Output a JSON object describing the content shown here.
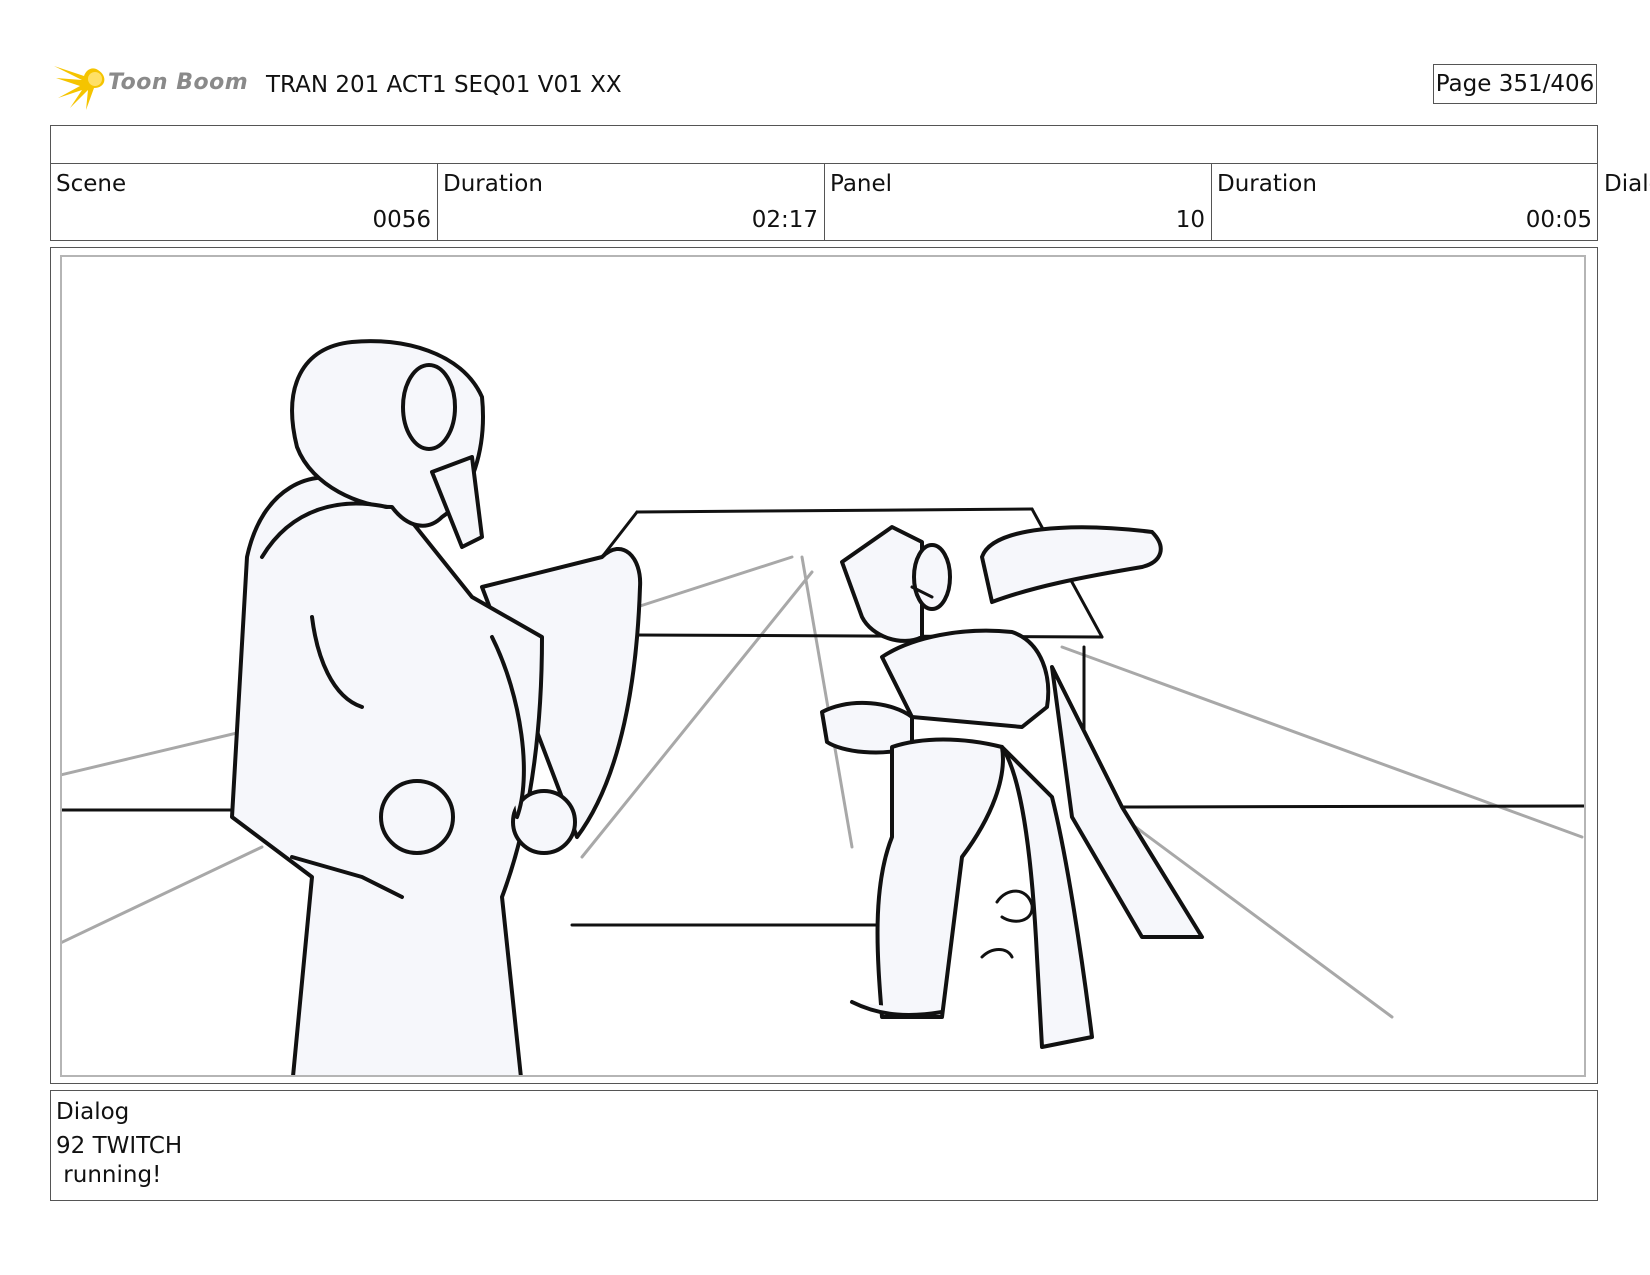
{
  "header": {
    "logo_text": "Toon Boom",
    "project_title": "TRAN 201 ACT1 SEQ01 V01 XX",
    "page_label": "Page 351/406"
  },
  "info": {
    "scene_label": "Scene",
    "scene_value": "0056",
    "scene_duration_label": "Duration",
    "scene_duration_value": "02:17",
    "panel_label": "Panel",
    "panel_value": "10",
    "panel_duration_label": "Duration",
    "panel_duration_value": "00:05",
    "overflow_label": "Dialo"
  },
  "dialog": {
    "label": "Dialog",
    "line1": "92 TWITCH",
    "line2": " running!"
  },
  "colors": {
    "logo_star": "#f5c400",
    "sketch_line": "#111111",
    "guide_line": "#a8a8a8",
    "figure_fill": "#f6f7fb"
  }
}
